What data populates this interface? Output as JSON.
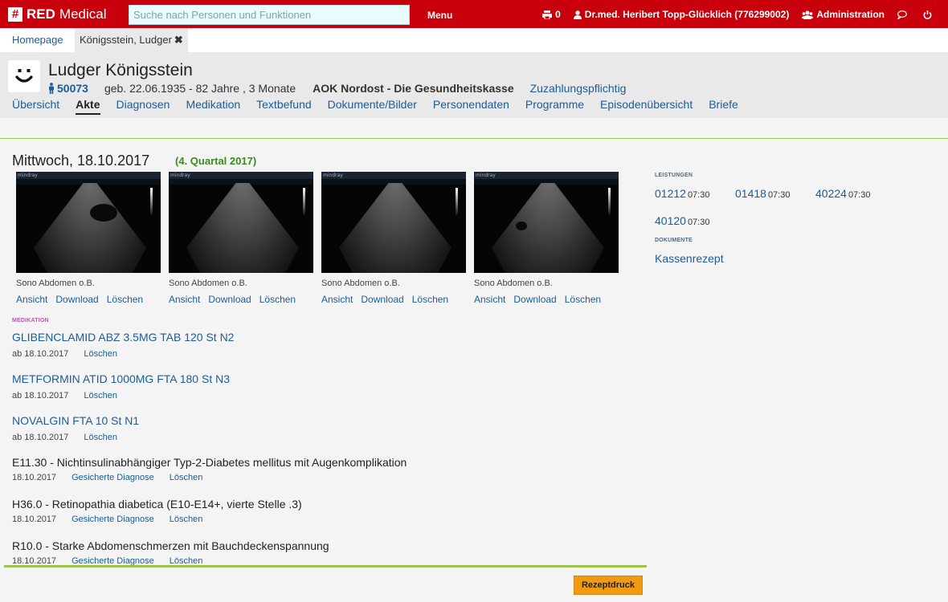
{
  "app": {
    "logo_icon": "#",
    "brand_bold": "RED",
    "brand_rest": "Medical"
  },
  "topbar": {
    "search_placeholder": "Suche nach Personen und Funktionen",
    "menu_label": "Menu",
    "print_count": "0",
    "user_label": "Dr.med. Heribert Topp-Glücklich (776299002)",
    "admin_label": "Administration",
    "icons": [
      "print-icon",
      "user-icon",
      "users-icon",
      "chat-icon",
      "power-icon"
    ]
  },
  "breadcrumbs": {
    "home": "Homepage",
    "active": "Königsstein, Ludger",
    "close_glyph": "✖"
  },
  "patient": {
    "name": "Ludger Königsstein",
    "id": "50073",
    "birth": "geb. 22.06.1935 - 82 Jahre , 3 Monate",
    "insurance": "AOK Nordost - Die Gesundheitskasse",
    "copay": "Zuzahlungspflichtig"
  },
  "nav": {
    "tabs": [
      {
        "label": "Übersicht"
      },
      {
        "label": "Akte",
        "active": true
      },
      {
        "label": "Diagnosen"
      },
      {
        "label": "Medikation"
      },
      {
        "label": "Textbefund"
      },
      {
        "label": "Dokumente/Bilder"
      },
      {
        "label": "Personendaten"
      },
      {
        "label": "Programme"
      },
      {
        "label": "Episodenübersicht"
      },
      {
        "label": "Briefe"
      }
    ]
  },
  "record": {
    "date": "Mittwoch, 18.10.2017",
    "quarter": "(4. Quartal 2017)",
    "images": [
      {
        "caption": "Sono Abdomen o.B.",
        "view": "Ansicht",
        "download": "Download",
        "delete": "Löschen",
        "brand": "mindray"
      },
      {
        "caption": "Sono Abdomen o.B.",
        "view": "Ansicht",
        "download": "Download",
        "delete": "Löschen",
        "brand": "mindray"
      },
      {
        "caption": "Sono Abdomen o.B.",
        "view": "Ansicht",
        "download": "Download",
        "delete": "Löschen",
        "brand": "mindray"
      },
      {
        "caption": "Sono Abdomen o.B.",
        "view": "Ansicht",
        "download": "Download",
        "delete": "Löschen",
        "brand": "mindray"
      }
    ],
    "medication_label": "Medikation",
    "medications": [
      {
        "name": "GLIBENCLAMID ABZ 3.5MG TAB 120 St N2",
        "since": "ab 18.10.2017",
        "delete": "Löschen"
      },
      {
        "name": "METFORMIN ATID 1000MG FTA 180 St N3",
        "since": "ab 18.10.2017",
        "delete": "Löschen"
      },
      {
        "name": "NOVALGIN FTA 10 St N1",
        "since": "ab 18.10.2017",
        "delete": "Löschen"
      }
    ],
    "diagnoses": [
      {
        "text": "E11.30 - Nichtinsulinabhängiger Typ-2-Diabetes mellitus mit Augenkomplikation",
        "date": "18.10.2017",
        "status": "Gesicherte Diagnose",
        "delete": "Löschen"
      },
      {
        "text": "H36.0 - Retinopathia diabetica (E10-E14+, vierte Stelle .3)",
        "date": "18.10.2017",
        "status": "Gesicherte Diagnose",
        "delete": "Löschen"
      },
      {
        "text": "R10.0 - Starke Abdomenschmerzen mit Bauchdeckenspannung",
        "date": "18.10.2017",
        "status": "Gesicherte Diagnose",
        "delete": "Löschen"
      }
    ]
  },
  "sidebar": {
    "leistungen_label": "Leistungen",
    "leistungen": [
      {
        "code": "01212",
        "time": "07:30"
      },
      {
        "code": "01418",
        "time": "07:30"
      },
      {
        "code": "40224",
        "time": "07:30"
      },
      {
        "code": "40120",
        "time": "07:30"
      }
    ],
    "dokumente_label": "Dokumente",
    "dokumente": [
      "Kassenrezept"
    ]
  },
  "footer": {
    "rezept_button": "Rezeptdruck"
  },
  "colors": {
    "brand_red": "#c8000c",
    "link_blue": "#1d5c96",
    "accent_green": "#9dc34a",
    "quarter_green": "#3a8a1d",
    "button_orange": "#f29b12"
  }
}
